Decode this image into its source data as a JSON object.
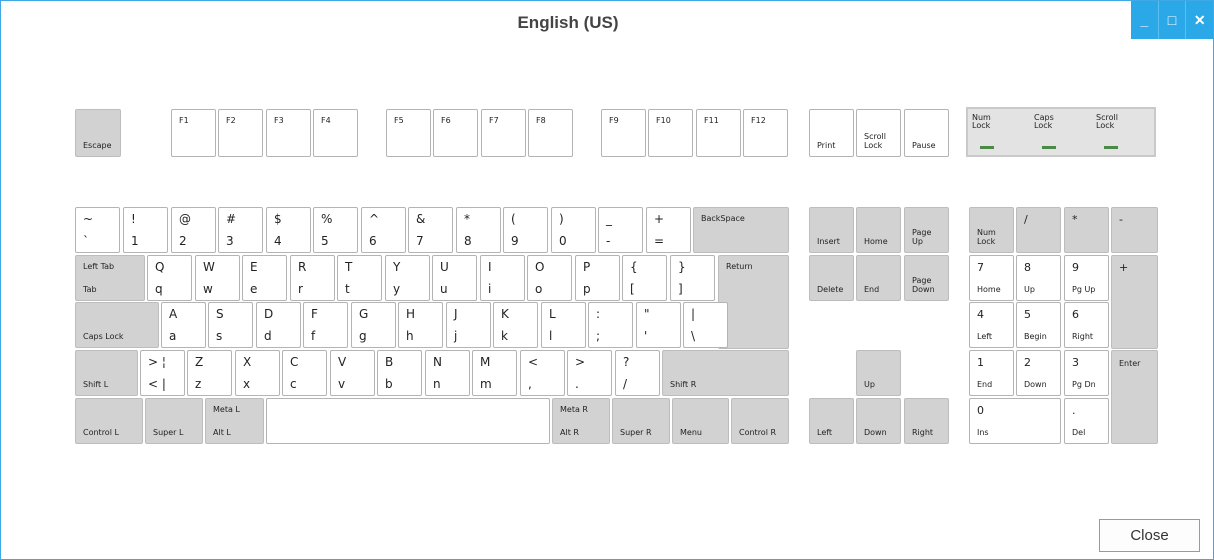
{
  "window": {
    "title": "English (US)",
    "minimize": "_",
    "maximize": "□",
    "close": "✕"
  },
  "close_button": "Close",
  "indicators": {
    "num_lock": "Num\nLock",
    "caps_lock": "Caps\nLock",
    "scroll_lock": "Scroll\nLock",
    "led_color": "#4a8a44"
  },
  "keys": [
    {
      "id": "escape",
      "b": "Escape",
      "g": true,
      "s": true
    },
    {
      "id": "f1",
      "t": "F1",
      "s": true
    },
    {
      "id": "f2",
      "t": "F2",
      "s": true
    },
    {
      "id": "f3",
      "t": "F3",
      "s": true
    },
    {
      "id": "f4",
      "t": "F4",
      "s": true
    },
    {
      "id": "f5",
      "t": "F5",
      "s": true
    },
    {
      "id": "f6",
      "t": "F6",
      "s": true
    },
    {
      "id": "f7",
      "t": "F7",
      "s": true
    },
    {
      "id": "f8",
      "t": "F8",
      "s": true
    },
    {
      "id": "f9",
      "t": "F9",
      "s": true
    },
    {
      "id": "f10",
      "t": "F10",
      "s": true
    },
    {
      "id": "f11",
      "t": "F11",
      "s": true
    },
    {
      "id": "f12",
      "t": "F12",
      "s": true
    },
    {
      "id": "print",
      "b": "Print",
      "s": true
    },
    {
      "id": "scroll-lock",
      "b": "Scroll\nLock",
      "s": true
    },
    {
      "id": "pause",
      "b": "Pause",
      "s": true
    },
    {
      "id": "grave",
      "t": "~",
      "b": "`",
      "big": true
    },
    {
      "id": "digit-1",
      "t": "!",
      "b": "1",
      "big": true
    },
    {
      "id": "digit-2",
      "t": "@",
      "b": "2",
      "big": true
    },
    {
      "id": "digit-3",
      "t": "#",
      "b": "3",
      "big": true
    },
    {
      "id": "digit-4",
      "t": "$",
      "b": "4",
      "big": true
    },
    {
      "id": "digit-5",
      "t": "%",
      "b": "5",
      "big": true
    },
    {
      "id": "digit-6",
      "t": "^",
      "b": "6",
      "big": true
    },
    {
      "id": "digit-7",
      "t": "&",
      "b": "7",
      "big": true
    },
    {
      "id": "digit-8",
      "t": "*",
      "b": "8",
      "big": true
    },
    {
      "id": "digit-9",
      "t": "(",
      "b": "9",
      "big": true
    },
    {
      "id": "digit-0",
      "t": ")",
      "b": "0",
      "big": true
    },
    {
      "id": "minus",
      "t": "_",
      "b": "-",
      "big": true
    },
    {
      "id": "equal",
      "t": "+",
      "b": "=",
      "big": true
    },
    {
      "id": "backspace",
      "t": "BackSpace",
      "g": true,
      "s": true
    },
    {
      "id": "tab",
      "t": "Left Tab",
      "b": "Tab",
      "g": true,
      "s": true
    },
    {
      "id": "key-q",
      "t": "Q",
      "b": "q",
      "big": true
    },
    {
      "id": "key-w",
      "t": "W",
      "b": "w",
      "big": true
    },
    {
      "id": "key-e",
      "t": "E",
      "b": "e",
      "big": true
    },
    {
      "id": "key-r",
      "t": "R",
      "b": "r",
      "big": true
    },
    {
      "id": "key-t",
      "t": "T",
      "b": "t",
      "big": true
    },
    {
      "id": "key-y",
      "t": "Y",
      "b": "y",
      "big": true
    },
    {
      "id": "key-u",
      "t": "U",
      "b": "u",
      "big": true
    },
    {
      "id": "key-i",
      "t": "I",
      "b": "i",
      "big": true
    },
    {
      "id": "key-o",
      "t": "O",
      "b": "o",
      "big": true
    },
    {
      "id": "key-p",
      "t": "P",
      "b": "p",
      "big": true
    },
    {
      "id": "bracket-left",
      "t": "{",
      "b": "[",
      "big": true
    },
    {
      "id": "bracket-right",
      "t": "}",
      "b": "]",
      "big": true
    },
    {
      "id": "return",
      "t": "Return",
      "g": true,
      "s": true
    },
    {
      "id": "caps-lock",
      "b": "Caps Lock",
      "g": true,
      "s": true
    },
    {
      "id": "key-a",
      "t": "A",
      "b": "a",
      "big": true
    },
    {
      "id": "key-s",
      "t": "S",
      "b": "s",
      "big": true
    },
    {
      "id": "key-d",
      "t": "D",
      "b": "d",
      "big": true
    },
    {
      "id": "key-f",
      "t": "F",
      "b": "f",
      "big": true
    },
    {
      "id": "key-g",
      "t": "G",
      "b": "g",
      "big": true
    },
    {
      "id": "key-h",
      "t": "H",
      "b": "h",
      "big": true
    },
    {
      "id": "key-j",
      "t": "J",
      "b": "j",
      "big": true
    },
    {
      "id": "key-k",
      "t": "K",
      "b": "k",
      "big": true
    },
    {
      "id": "key-l",
      "t": "L",
      "b": "l",
      "big": true
    },
    {
      "id": "semicolon",
      "t": ":",
      "b": ";",
      "big": true
    },
    {
      "id": "quote",
      "t": "\"",
      "b": "'",
      "big": true
    },
    {
      "id": "backslash",
      "t": "|",
      "b": "\\",
      "big": true
    },
    {
      "id": "shift-left",
      "b": "Shift L",
      "g": true,
      "s": true
    },
    {
      "id": "less-greater",
      "t": ">  ¦",
      "b": "<  |",
      "big": true
    },
    {
      "id": "key-z",
      "t": "Z",
      "b": "z",
      "big": true
    },
    {
      "id": "key-x",
      "t": "X",
      "b": "x",
      "big": true
    },
    {
      "id": "key-c",
      "t": "C",
      "b": "c",
      "big": true
    },
    {
      "id": "key-v",
      "t": "V",
      "b": "v",
      "big": true
    },
    {
      "id": "key-b",
      "t": "B",
      "b": "b",
      "big": true
    },
    {
      "id": "key-n",
      "t": "N",
      "b": "n",
      "big": true
    },
    {
      "id": "key-m",
      "t": "M",
      "b": "m",
      "big": true
    },
    {
      "id": "comma",
      "t": "<",
      "b": ",",
      "big": true
    },
    {
      "id": "period",
      "t": ">",
      "b": ".",
      "big": true
    },
    {
      "id": "slash",
      "t": "?",
      "b": "/",
      "big": true
    },
    {
      "id": "shift-right",
      "b": "Shift R",
      "g": true,
      "s": true
    },
    {
      "id": "control-left",
      "b": "Control L",
      "g": true,
      "s": true
    },
    {
      "id": "super-left",
      "b": "Super L",
      "g": true,
      "s": true
    },
    {
      "id": "alt-left",
      "t": "Meta L",
      "b": "Alt L",
      "g": true,
      "s": true
    },
    {
      "id": "space"
    },
    {
      "id": "alt-right",
      "t": "Meta R",
      "b": "Alt R",
      "g": true,
      "s": true
    },
    {
      "id": "super-right",
      "b": "Super R",
      "g": true,
      "s": true
    },
    {
      "id": "menu",
      "b": "Menu",
      "g": true,
      "s": true
    },
    {
      "id": "control-right",
      "b": "Control R",
      "g": true,
      "s": true
    },
    {
      "id": "insert",
      "b": "Insert",
      "g": true,
      "s": true
    },
    {
      "id": "home",
      "b": "Home",
      "g": true,
      "s": true
    },
    {
      "id": "page-up",
      "b": "Page\nUp",
      "g": true,
      "s": true
    },
    {
      "id": "delete",
      "b": "Delete",
      "g": true,
      "s": true
    },
    {
      "id": "end",
      "b": "End",
      "g": true,
      "s": true
    },
    {
      "id": "page-down",
      "b": "Page\nDown",
      "g": true,
      "s": true
    },
    {
      "id": "arrow-up",
      "b": "Up",
      "g": true,
      "s": true
    },
    {
      "id": "arrow-left",
      "b": "Left",
      "g": true,
      "s": true
    },
    {
      "id": "arrow-down",
      "b": "Down",
      "g": true,
      "s": true
    },
    {
      "id": "arrow-right",
      "b": "Right",
      "g": true,
      "s": true
    },
    {
      "id": "num-lock",
      "b": "Num\nLock",
      "g": true,
      "s": true
    },
    {
      "id": "kp-divide",
      "t": "/",
      "g": true
    },
    {
      "id": "kp-multiply",
      "t": "*",
      "g": true
    },
    {
      "id": "kp-subtract",
      "t": "-",
      "g": true
    },
    {
      "id": "kp-7",
      "t": "7",
      "b": "Home",
      "w": true,
      "smallb": true
    },
    {
      "id": "kp-8",
      "t": "8",
      "b": "Up",
      "w": true,
      "smallb": true
    },
    {
      "id": "kp-9",
      "t": "9",
      "b": "Pg Up",
      "w": true,
      "smallb": true
    },
    {
      "id": "kp-add",
      "t": "+",
      "g": true
    },
    {
      "id": "kp-4",
      "t": "4",
      "b": "Left",
      "w": true,
      "smallb": true
    },
    {
      "id": "kp-5",
      "t": "5",
      "b": "Begin",
      "w": true,
      "smallb": true
    },
    {
      "id": "kp-6",
      "t": "6",
      "b": "Right",
      "w": true,
      "smallb": true
    },
    {
      "id": "kp-1",
      "t": "1",
      "b": "End",
      "w": true,
      "smallb": true
    },
    {
      "id": "kp-2",
      "t": "2",
      "b": "Down",
      "w": true,
      "smallb": true
    },
    {
      "id": "kp-3",
      "t": "3",
      "b": "Pg Dn",
      "w": true,
      "smallb": true
    },
    {
      "id": "kp-enter",
      "t": "Enter",
      "g": true,
      "s": true,
      "mid": true
    },
    {
      "id": "kp-0",
      "t": "0",
      "b": "Ins",
      "w": true,
      "smallb": true
    },
    {
      "id": "kp-decimal",
      "t": ".",
      "b": "Del",
      "w": true,
      "smallb": true
    }
  ]
}
